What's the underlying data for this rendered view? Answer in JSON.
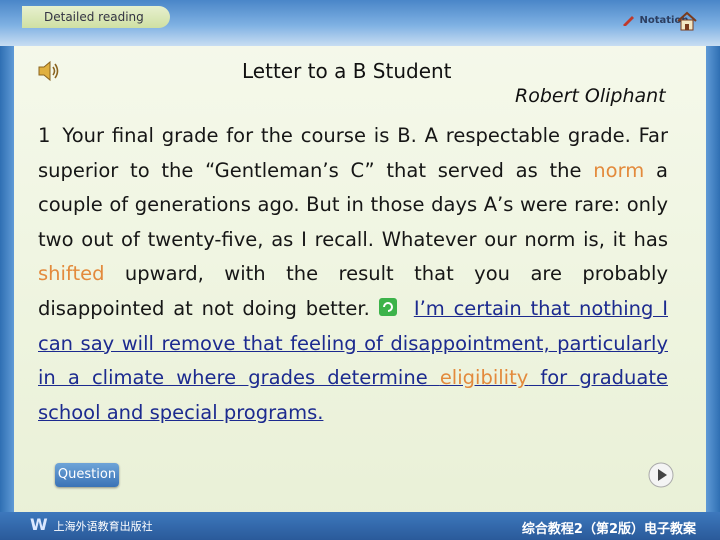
{
  "header": {
    "tab_label": "Detailed reading",
    "notation_label": "Notation"
  },
  "title": "Letter to a B Student",
  "author": "Robert Oliphant",
  "paragraph": {
    "number": "1",
    "part1": "Your final grade for the course is B. A respectable grade. Far superior to the “Gentleman’s C” that served as the ",
    "word_norm": "norm",
    "part2": " a couple of generations ago. But in those days A’s were rare: only two out of twenty-five, as I recall. Whatever our norm is, it has ",
    "word_shifted": "shifted",
    "part3": " upward, with the result that you are probably disappointed at not doing better.",
    "underlined1": "I’m certain that nothing I can say will remove that feeling of disappointment, particularly in a climate where grades determine ",
    "word_eligibility": "eligibility",
    "underlined2": " for graduate school and special programs."
  },
  "buttons": {
    "question": "Question"
  },
  "footer": {
    "publisher": "上海外语教育出版社",
    "course": "综合教程2（第2版）电子教案"
  },
  "colors": {
    "highlight": "#e38a3c",
    "underline_text": "#1c2a8f",
    "frame_blue": "#2f6fb3"
  }
}
